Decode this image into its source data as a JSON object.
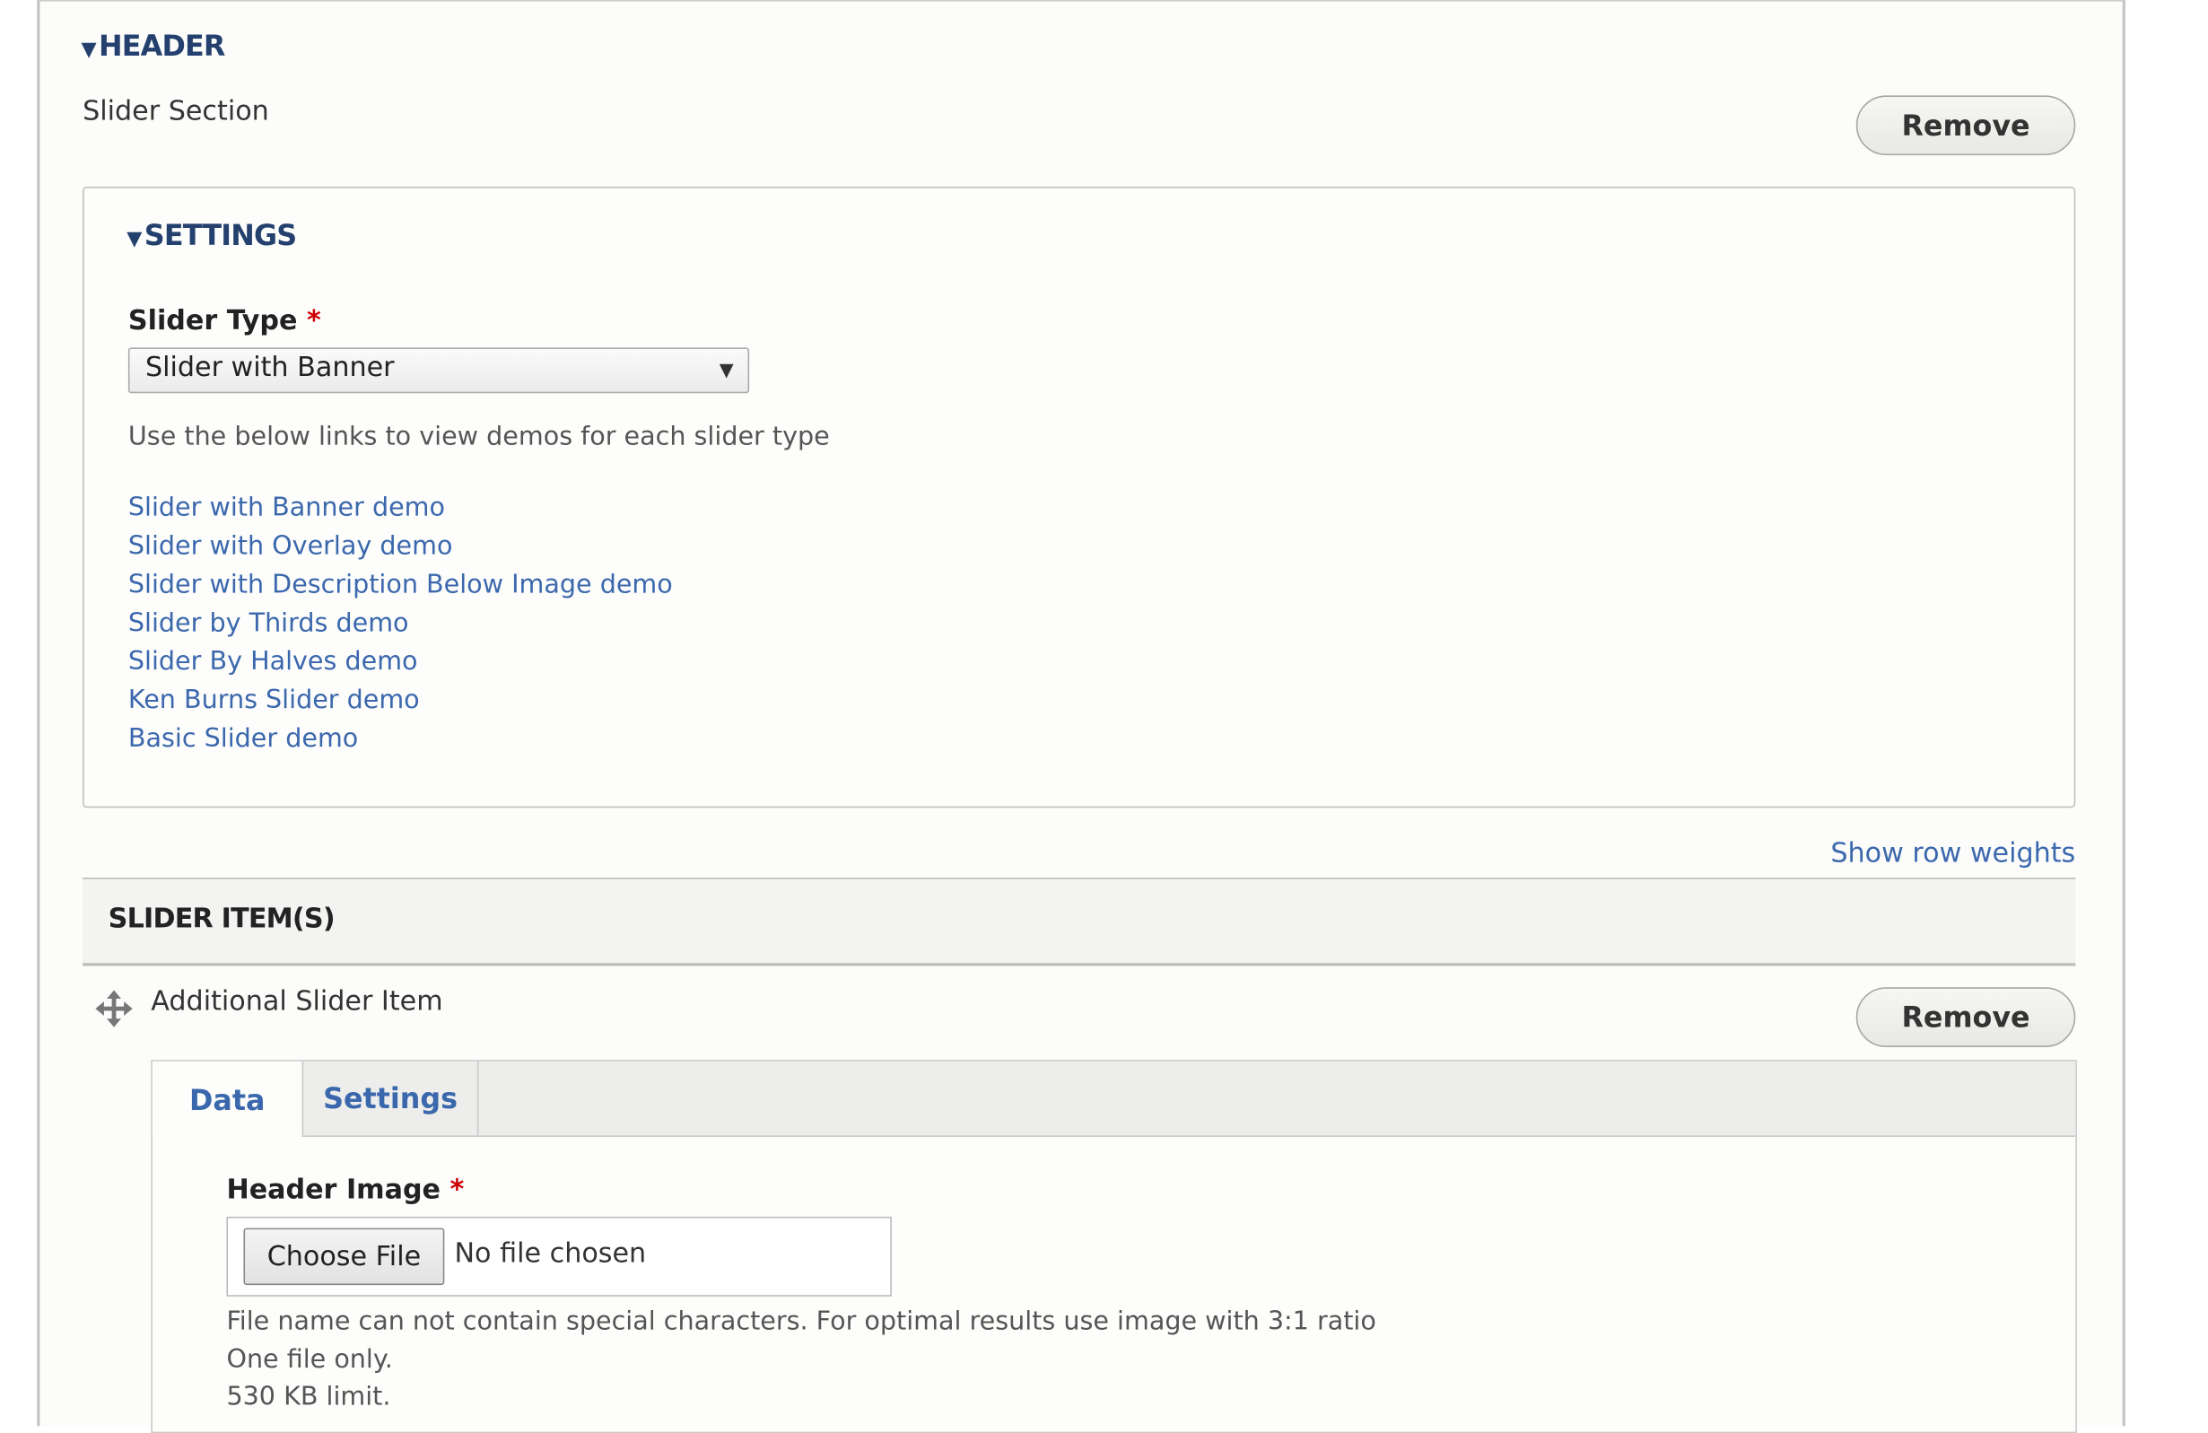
{
  "header": {
    "title": "HEADER",
    "section_label": "Slider Section",
    "remove_label": "Remove"
  },
  "settings": {
    "title": "SETTINGS",
    "slider_type_label": "Slider Type",
    "required_mark": "*",
    "slider_type_value": "Slider with Banner",
    "help": "Use the below links to view demos for each slider type",
    "links": [
      "Slider with Banner demo",
      "Slider with Overlay demo",
      "Slider with Description Below Image demo",
      "Slider by Thirds demo",
      "Slider By Halves demo",
      "Ken Burns Slider demo",
      "Basic Slider demo"
    ]
  },
  "table": {
    "show_row_weights": "Show row weights",
    "column_header": "SLIDER ITEM(S)",
    "row": {
      "label": "Additional Slider Item",
      "remove_label": "Remove"
    }
  },
  "tabs": [
    {
      "label": "Data",
      "active": true
    },
    {
      "label": "Settings",
      "active": false
    }
  ],
  "data_tab": {
    "header_image_label": "Header Image",
    "required_mark": "*",
    "choose_file": "Choose File",
    "no_file": "No file chosen",
    "help_lines": [
      "File name can not contain special characters. For optimal results use image with 3:1 ratio",
      "One file only.",
      "530 KB limit."
    ]
  },
  "colors": {
    "link": "#3b68ad",
    "summary": "#24406e",
    "required": "#cc0000"
  }
}
